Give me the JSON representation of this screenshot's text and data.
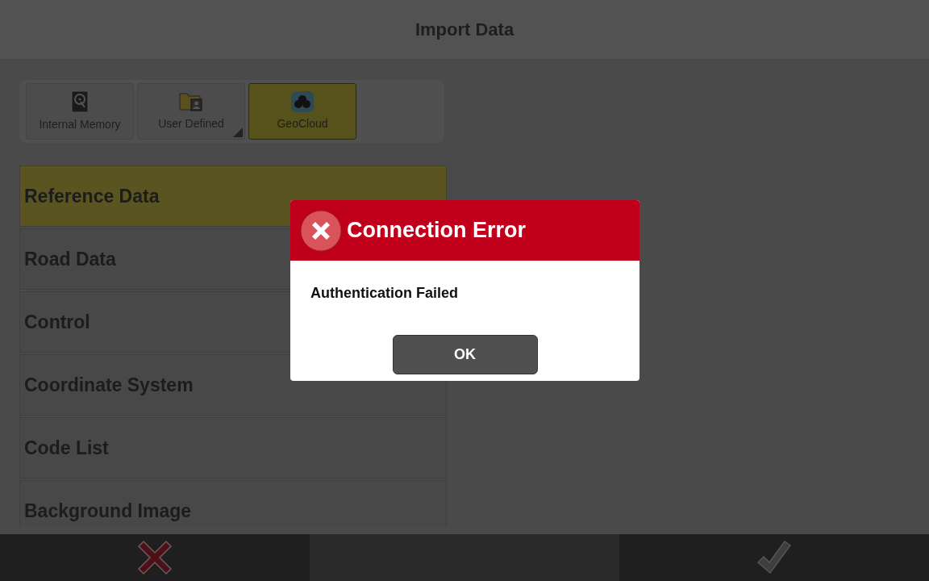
{
  "window": {
    "title": "Import Data"
  },
  "sources": [
    {
      "label": "Internal Memory",
      "kind": "drive",
      "selected": false,
      "submenu": false
    },
    {
      "label": "User Defined",
      "kind": "folder",
      "selected": false,
      "submenu": true
    },
    {
      "label": "GeoCloud",
      "kind": "cloud",
      "selected": true,
      "submenu": false
    }
  ],
  "categories": [
    {
      "label": "Reference Data",
      "selected": true
    },
    {
      "label": "Road Data",
      "selected": false
    },
    {
      "label": "Control",
      "selected": false
    },
    {
      "label": "Coordinate System",
      "selected": false
    },
    {
      "label": "Code List",
      "selected": false
    },
    {
      "label": "Background Image",
      "selected": false
    }
  ],
  "dialog": {
    "title": "Connection Error",
    "message": "Authentication Failed",
    "button": "OK"
  },
  "footer": [
    {
      "kind": "cancel"
    },
    {
      "kind": "empty"
    },
    {
      "kind": "confirm"
    }
  ]
}
